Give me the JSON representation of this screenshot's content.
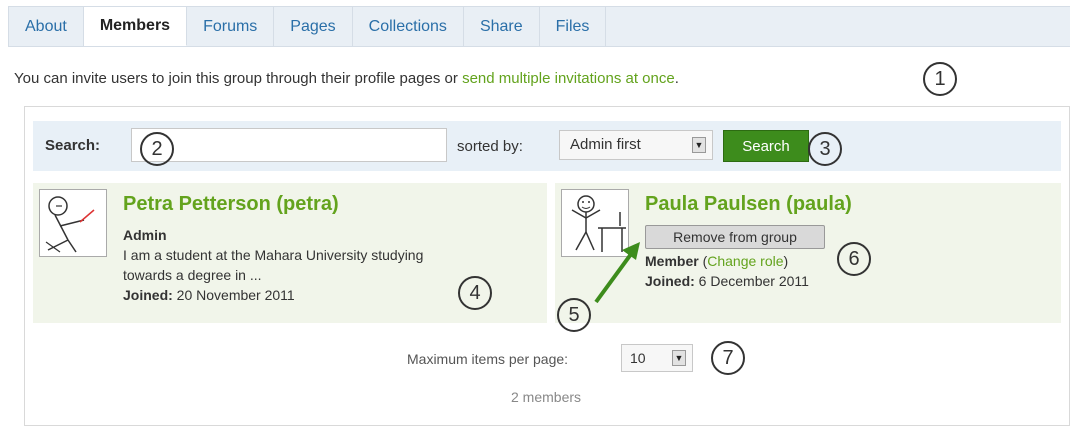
{
  "tabs": [
    {
      "label": "About",
      "active": false
    },
    {
      "label": "Members",
      "active": true
    },
    {
      "label": "Forums",
      "active": false
    },
    {
      "label": "Pages",
      "active": false
    },
    {
      "label": "Collections",
      "active": false
    },
    {
      "label": "Share",
      "active": false
    },
    {
      "label": "Files",
      "active": false
    }
  ],
  "intro": {
    "text": "You can invite users to join this group through their profile pages or ",
    "link": "send multiple invitations at once",
    "end": "."
  },
  "search": {
    "label": "Search:",
    "value": "",
    "sorted_by_label": "sorted by:",
    "sort_value": "Admin first",
    "button": "Search"
  },
  "members": [
    {
      "name": "Petra Petterson (petra)",
      "role": "Admin",
      "bio_line1": "I am a student at the Mahara University studying",
      "bio_line2": "towards a degree in ...",
      "joined_label": "Joined:",
      "joined_date": " 20 November 2011"
    },
    {
      "name": "Paula Paulsen (paula)",
      "remove_button": "Remove from group",
      "role": "Member",
      "change_role_open": " (",
      "change_role": "Change role",
      "change_role_close": ")",
      "joined_label": "Joined:",
      "joined_date": " 6 December 2011"
    }
  ],
  "footer": {
    "max_items_label": "Maximum items per page:",
    "max_items_value": "10",
    "count": "2 members"
  },
  "callouts": [
    "1",
    "2",
    "3",
    "4",
    "5",
    "6",
    "7"
  ],
  "colors": {
    "accent": "#63a31d",
    "button": "#3d8c1c",
    "tab_link": "#2a6fa8"
  },
  "icons": {
    "select_arrow": "chevron-down-icon"
  }
}
